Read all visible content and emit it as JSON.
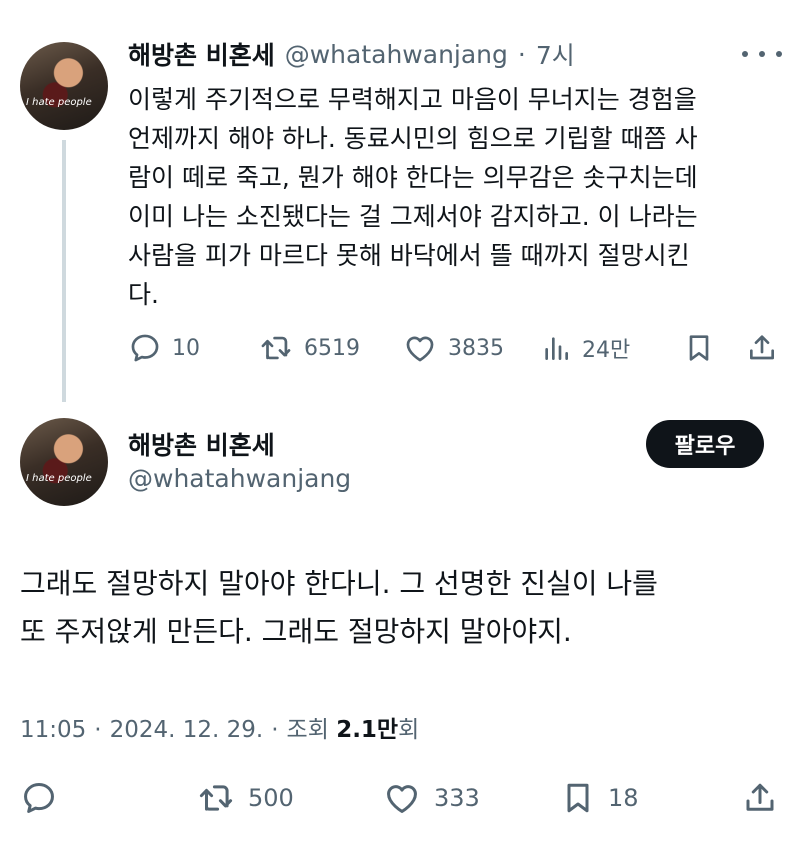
{
  "tweet1": {
    "display_name": "해방촌 비혼세",
    "handle": "@whatahwanjang",
    "time": "7시",
    "avatar_text": "I hate people",
    "body": "이렇게 주기적으로 무력해지고 마음이 무너지는 경험을\n언제까지 해야 하나. 동료시민의 힘으로 기립할 때쯤 사\n람이 떼로 죽고, 뭔가 해야 한다는 의무감은 솟구치는데\n이미 나는 소진됐다는 걸 그제서야 감지하고. 이 나라는\n사람을 피가 마르다 못해 바닥에서 뜰 때까지 절망시킨\n다.",
    "replies": "10",
    "reposts": "6519",
    "likes": "3835",
    "views": "24만"
  },
  "tweet2": {
    "display_name": "해방촌 비혼세",
    "handle": "@whatahwanjang",
    "avatar_text": "I hate people",
    "follow_label": "팔로우",
    "body": "그래도 절망하지 말아야 한다니. 그 선명한 진실이 나를\n또 주저앉게 만든다. 그래도 절망하지 말아야지.",
    "time": "11:05",
    "date": "2024. 12. 29.",
    "views_label": "조회",
    "views_count": "2.1만",
    "views_suffix": "회",
    "reposts": "500",
    "likes": "333",
    "bookmarks": "18"
  },
  "colors": {
    "text": "#0f1419",
    "secondary": "#536471",
    "thread_line": "#cfd9de",
    "button_bg": "#0f1419"
  },
  "icons": [
    "reply-icon",
    "repost-icon",
    "like-icon",
    "views-icon",
    "bookmark-icon",
    "share-icon",
    "more-icon"
  ]
}
